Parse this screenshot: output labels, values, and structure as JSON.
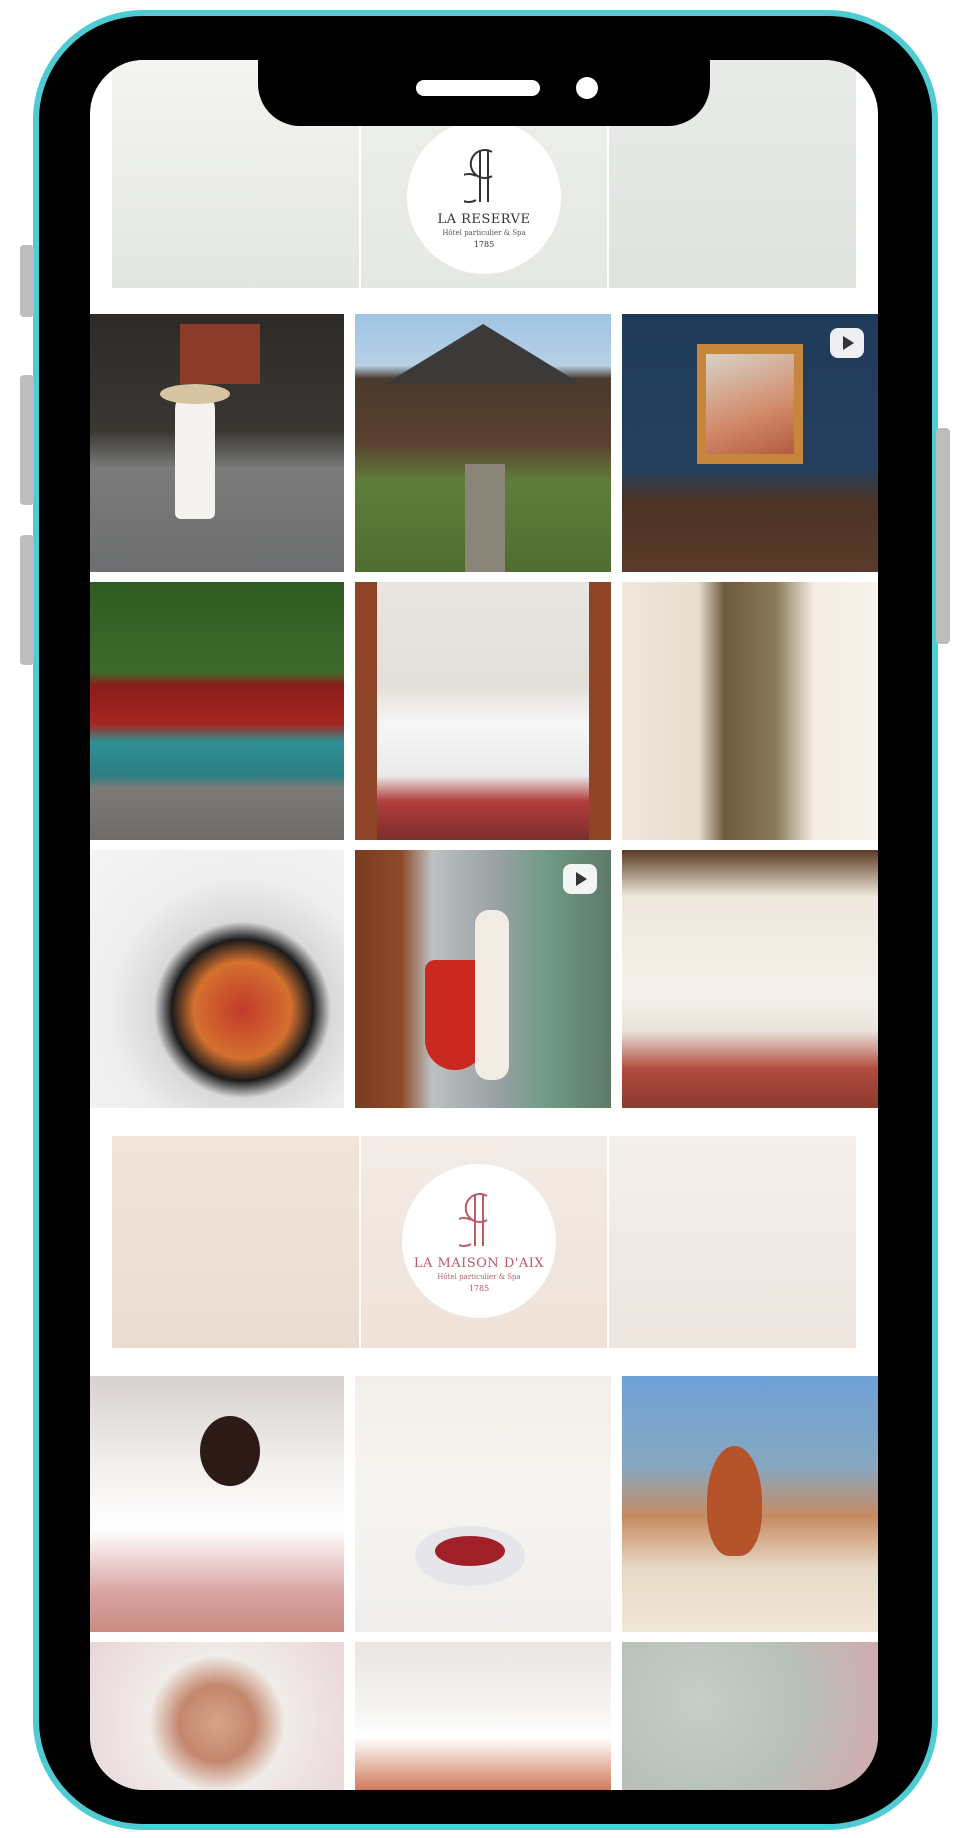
{
  "brands": [
    {
      "name": "LA RESERVE",
      "tagline": "Hôtel particulier & Spa",
      "year": "1785",
      "color": "#333333"
    },
    {
      "name": "LA MAISON D'AIX",
      "tagline": "Hôtel particulier & Spa",
      "year": "1785",
      "color": "#b85d66"
    }
  ],
  "colors": {
    "frame_accent": "#4fcbd3",
    "frame_body": "#000000",
    "screen_bg": "#ffffff"
  },
  "icons": {
    "reel": "reel-icon"
  }
}
